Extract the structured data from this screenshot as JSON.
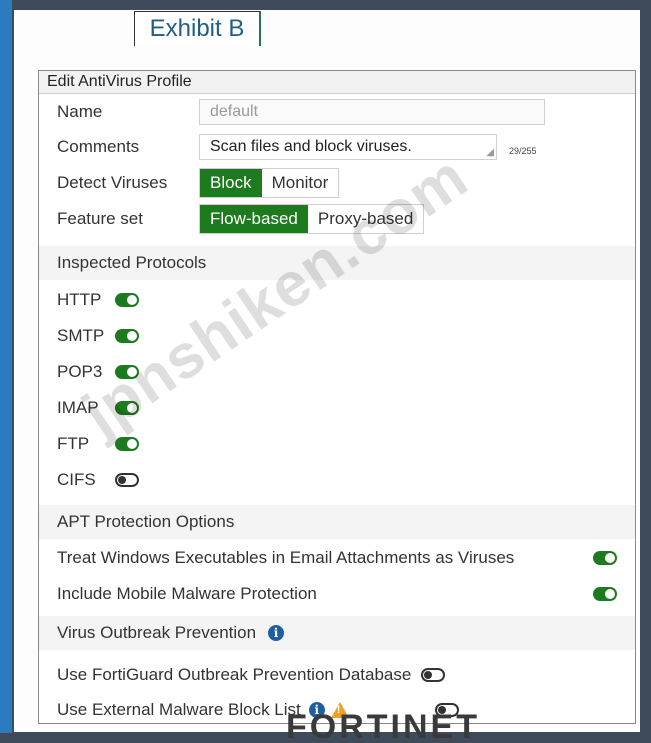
{
  "exhibit": {
    "label": "Exhibit B"
  },
  "panel": {
    "title": "Edit AntiVirus Profile"
  },
  "form": {
    "name": {
      "label": "Name",
      "value": "default"
    },
    "comments": {
      "label": "Comments",
      "value": "Scan files and block viruses.",
      "counter": "29/255"
    },
    "detect_viruses": {
      "label": "Detect Viruses",
      "options": [
        "Block",
        "Monitor"
      ],
      "selected": "Block"
    },
    "feature_set": {
      "label": "Feature set",
      "options": [
        "Flow-based",
        "Proxy-based"
      ],
      "selected": "Flow-based"
    }
  },
  "inspected_protocols": {
    "title": "Inspected Protocols",
    "items": [
      {
        "label": "HTTP",
        "enabled": true
      },
      {
        "label": "SMTP",
        "enabled": true
      },
      {
        "label": "POP3",
        "enabled": true
      },
      {
        "label": "IMAP",
        "enabled": true
      },
      {
        "label": "FTP",
        "enabled": true
      },
      {
        "label": "CIFS",
        "enabled": false
      }
    ]
  },
  "apt": {
    "title": "APT Protection Options",
    "items": [
      {
        "label": "Treat Windows Executables in Email Attachments as Viruses",
        "enabled": true
      },
      {
        "label": "Include Mobile Malware Protection",
        "enabled": true
      }
    ]
  },
  "outbreak": {
    "title": "Virus Outbreak Prevention",
    "title_icon": "info-icon",
    "items": [
      {
        "label": "Use FortiGuard Outbreak Prevention Database",
        "enabled": false
      },
      {
        "label": "Use External Malware Block List",
        "enabled": false,
        "icons": [
          "info-icon",
          "warning-icon"
        ]
      }
    ]
  },
  "colors": {
    "accent_green": "#1e7a1e",
    "info_blue": "#1f5fa0",
    "warning_orange": "#f0a020"
  },
  "watermark": "jpnshiken.com",
  "brand": "FORTINET"
}
